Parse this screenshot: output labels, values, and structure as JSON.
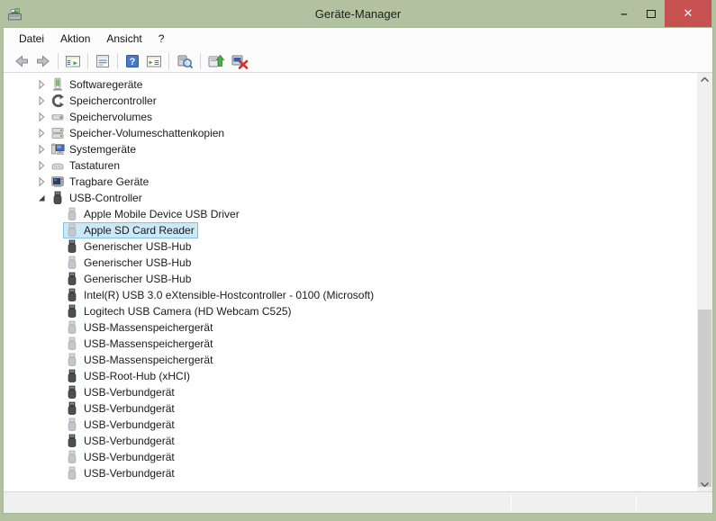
{
  "window": {
    "title": "Geräte-Manager",
    "controls": {
      "minimize": "‒",
      "maximize": "",
      "close": "✕"
    }
  },
  "menubar": {
    "items": [
      {
        "label": "Datei"
      },
      {
        "label": "Aktion"
      },
      {
        "label": "Ansicht"
      },
      {
        "label": "?"
      }
    ]
  },
  "toolbar": {
    "icons": [
      "back-icon",
      "forward-icon",
      "show-console-tree-icon",
      "properties-icon",
      "help-icon",
      "action-pane-icon",
      "scan-hardware-changes-icon",
      "update-driver-icon",
      "uninstall-device-icon"
    ]
  },
  "colors": {
    "frame_green": "#b2c1a0",
    "close_red": "#c75050",
    "selection_bg": "#cbe8f6",
    "selection_border": "#84c3e8",
    "usb_dark": "#4c4f53",
    "usb_light": "#c3c7cb"
  },
  "tree": {
    "items": [
      {
        "label": "Softwaregeräte",
        "level": 0,
        "expand": "collapsed",
        "icon": "software-device-icon"
      },
      {
        "label": "Speichercontroller",
        "level": 0,
        "expand": "collapsed",
        "icon": "storage-controller-icon"
      },
      {
        "label": "Speichervolumes",
        "level": 0,
        "expand": "collapsed",
        "icon": "disk-drive-icon"
      },
      {
        "label": "Speicher-Volumeschattenkopien",
        "level": 0,
        "expand": "collapsed",
        "icon": "shadow-copy-icon"
      },
      {
        "label": "Systemgeräte",
        "level": 0,
        "expand": "collapsed",
        "icon": "system-device-icon"
      },
      {
        "label": "Tastaturen",
        "level": 0,
        "expand": "collapsed",
        "icon": "keyboard-icon"
      },
      {
        "label": "Tragbare Geräte",
        "level": 0,
        "expand": "collapsed",
        "icon": "portable-device-icon"
      },
      {
        "label": "USB-Controller",
        "level": 0,
        "expand": "expanded",
        "icon": "usb-icon",
        "variant": "dark"
      },
      {
        "label": "Apple Mobile Device USB Driver",
        "level": 1,
        "icon": "usb-icon",
        "variant": "light"
      },
      {
        "label": "Apple SD Card Reader",
        "level": 1,
        "icon": "usb-icon",
        "variant": "light",
        "selected": true
      },
      {
        "label": "Generischer USB-Hub",
        "level": 1,
        "icon": "usb-icon",
        "variant": "dark"
      },
      {
        "label": "Generischer USB-Hub",
        "level": 1,
        "icon": "usb-icon",
        "variant": "light"
      },
      {
        "label": "Generischer USB-Hub",
        "level": 1,
        "icon": "usb-icon",
        "variant": "dark"
      },
      {
        "label": "Intel(R) USB 3.0 eXtensible-Hostcontroller - 0100 (Microsoft)",
        "level": 1,
        "icon": "usb-icon",
        "variant": "dark"
      },
      {
        "label": "Logitech USB Camera (HD Webcam C525)",
        "level": 1,
        "icon": "usb-icon",
        "variant": "dark"
      },
      {
        "label": "USB-Massenspeichergerät",
        "level": 1,
        "icon": "usb-icon",
        "variant": "light"
      },
      {
        "label": "USB-Massenspeichergerät",
        "level": 1,
        "icon": "usb-icon",
        "variant": "light"
      },
      {
        "label": "USB-Massenspeichergerät",
        "level": 1,
        "icon": "usb-icon",
        "variant": "light"
      },
      {
        "label": "USB-Root-Hub (xHCI)",
        "level": 1,
        "icon": "usb-icon",
        "variant": "dark"
      },
      {
        "label": "USB-Verbundgerät",
        "level": 1,
        "icon": "usb-icon",
        "variant": "dark"
      },
      {
        "label": "USB-Verbundgerät",
        "level": 1,
        "icon": "usb-icon",
        "variant": "dark"
      },
      {
        "label": "USB-Verbundgerät",
        "level": 1,
        "icon": "usb-icon",
        "variant": "light"
      },
      {
        "label": "USB-Verbundgerät",
        "level": 1,
        "icon": "usb-icon",
        "variant": "dark"
      },
      {
        "label": "USB-Verbundgerät",
        "level": 1,
        "icon": "usb-icon",
        "variant": "light"
      },
      {
        "label": "USB-Verbundgerät",
        "level": 1,
        "icon": "usb-icon",
        "variant": "light"
      }
    ]
  }
}
